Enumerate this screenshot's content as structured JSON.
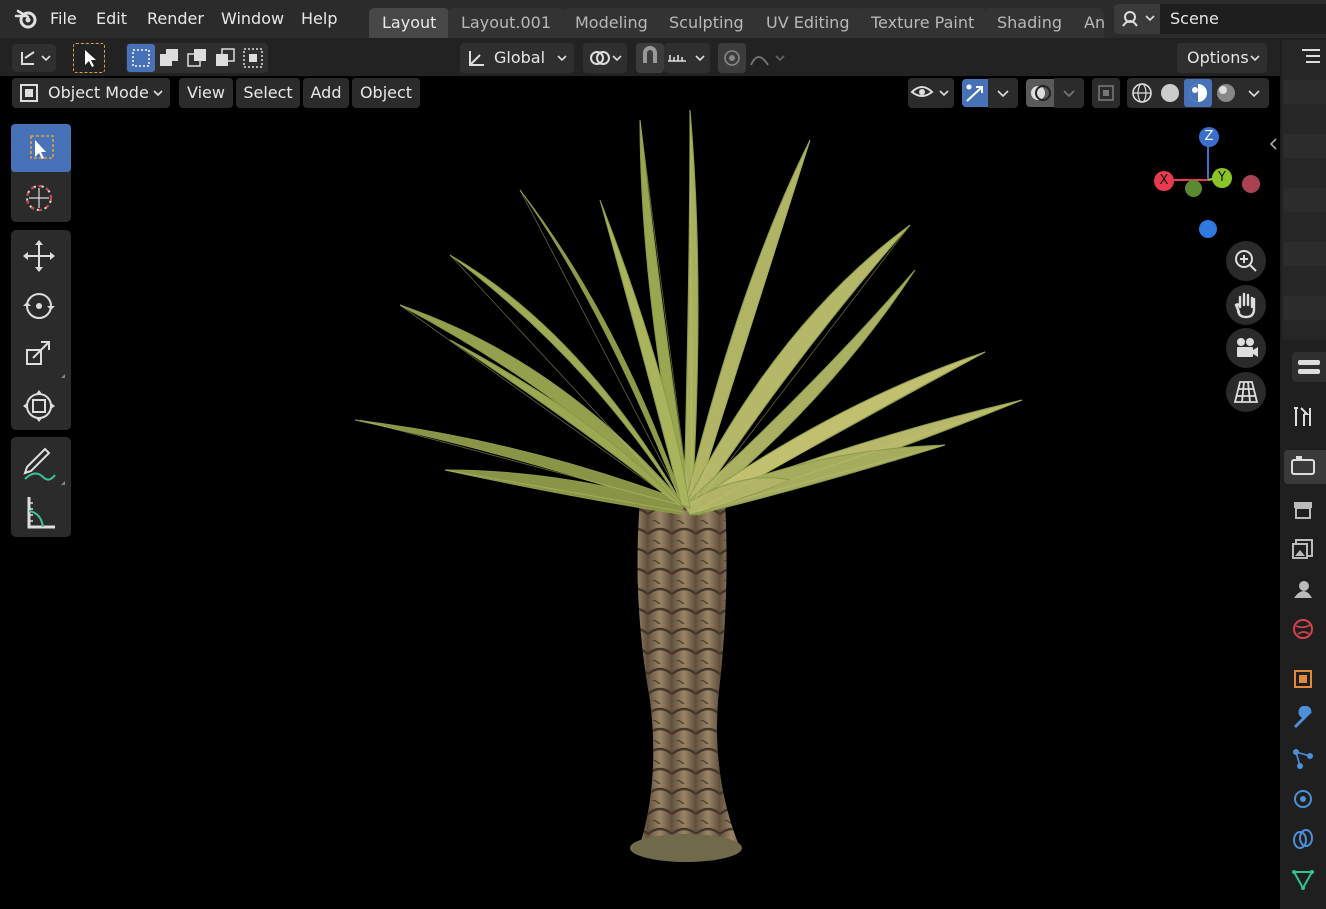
{
  "menubar": {
    "items": [
      "File",
      "Edit",
      "Render",
      "Window",
      "Help"
    ]
  },
  "workspaces": {
    "tabs": [
      "Layout",
      "Layout.001",
      "Modeling",
      "Sculpting",
      "UV Editing",
      "Texture Paint",
      "Shading",
      "An"
    ],
    "active": "Layout"
  },
  "scene": {
    "name": "Scene"
  },
  "tool_settings": {
    "transform_orientation": "Global",
    "options_label": "Options"
  },
  "viewport_header": {
    "mode": "Object Mode",
    "menus": [
      "View",
      "Select",
      "Add",
      "Object"
    ]
  },
  "gizmo": {
    "axes": [
      "Z",
      "Y",
      "X"
    ],
    "colors": {
      "x": "#e83a4d",
      "y": "#8ac427",
      "z": "#3b6fcf",
      "neg_x": "#a8424f",
      "neg_y": "#5c8a33",
      "neg_z": "#2f7ae0"
    }
  },
  "icons": {
    "blender_logo": "blender-logo-icon",
    "tools": [
      "select-box-icon",
      "cursor-icon",
      "move-icon",
      "rotate-icon",
      "scale-icon",
      "transform-icon",
      "annotate-icon",
      "measure-icon"
    ],
    "nav": [
      "zoom-icon",
      "hand-pan-icon",
      "camera-icon",
      "grid-ortho-icon"
    ],
    "properties": [
      "tool-icon",
      "render-icon",
      "output-icon",
      "view-layer-icon",
      "scene-icon",
      "world-icon",
      "object-icon",
      "modifier-icon",
      "particles-icon",
      "physics-icon",
      "constraints-icon",
      "data-icon"
    ]
  },
  "colors": {
    "accent": "#4872b8",
    "background": "#000000",
    "panel": "#2b2b2b"
  }
}
